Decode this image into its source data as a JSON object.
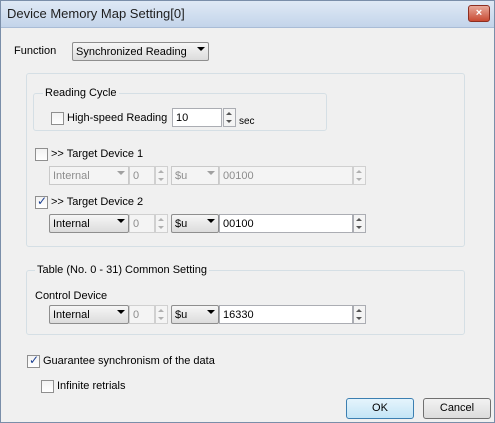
{
  "window": {
    "title": "Device Memory Map Setting[0]",
    "close_label": "×"
  },
  "function": {
    "label": "Function",
    "value": "Synchronized Reading"
  },
  "reading_cycle": {
    "group_label": "Reading Cycle",
    "high_speed_label": "High-speed Reading",
    "high_speed_checked": false,
    "value": "10",
    "unit": "sec"
  },
  "target1": {
    "label": ">> Target Device 1",
    "checked": false,
    "device": "Internal",
    "station": "0",
    "type": "$u",
    "address": "00100"
  },
  "target2": {
    "label": ">> Target Device 2",
    "checked": true,
    "device": "Internal",
    "station": "0",
    "type": "$u",
    "address": "00100"
  },
  "common": {
    "group_label": "Table (No. 0 - 31) Common Setting",
    "control_label": "Control Device",
    "device": "Internal",
    "station": "0",
    "type": "$u",
    "address": "16330"
  },
  "guarantee": {
    "label": "Guarantee synchronism of the data",
    "checked": true
  },
  "infinite": {
    "label": "Infinite retrials",
    "checked": false
  },
  "buttons": {
    "ok": "OK",
    "cancel": "Cancel"
  }
}
